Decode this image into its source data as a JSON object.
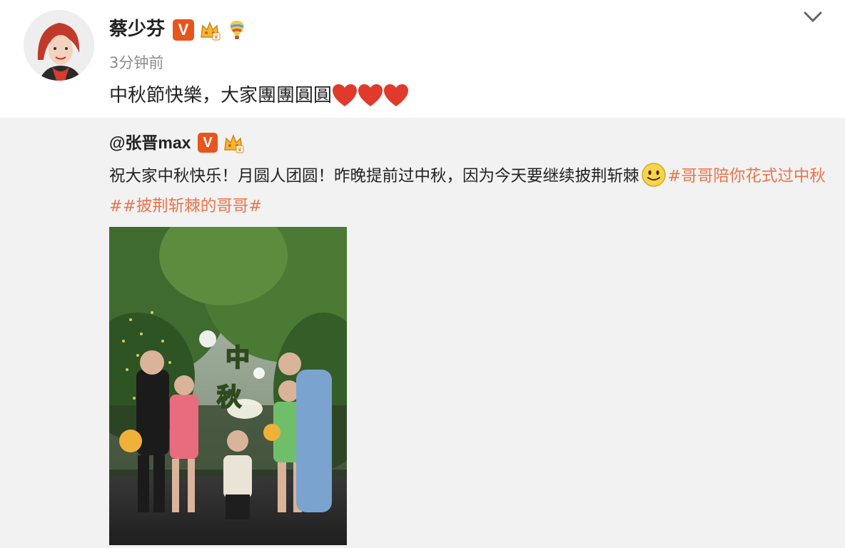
{
  "post": {
    "username": "蔡少芬",
    "timestamp": "3分钟前",
    "content": "中秋節快樂，大家團團圓圓",
    "hearts": 3,
    "badges": [
      "verified-v-badge",
      "crown-badge",
      "balloon-badge"
    ],
    "colors": {
      "accent": "#e8541e",
      "topic": "#e8754b",
      "heart": "#e03a2c"
    }
  },
  "repost": {
    "username": "@张晋max",
    "badges": [
      "verified-v-badge",
      "crown-badge"
    ],
    "text": "祝大家中秋快乐！月圆人团圆！昨晚提前过中秋，因为今天要继续披荆斩棘",
    "topics": [
      "#哥哥陪你花式过中秋#",
      "#披荆斩棘的哥哥#"
    ],
    "photo_caption": "中秋"
  }
}
